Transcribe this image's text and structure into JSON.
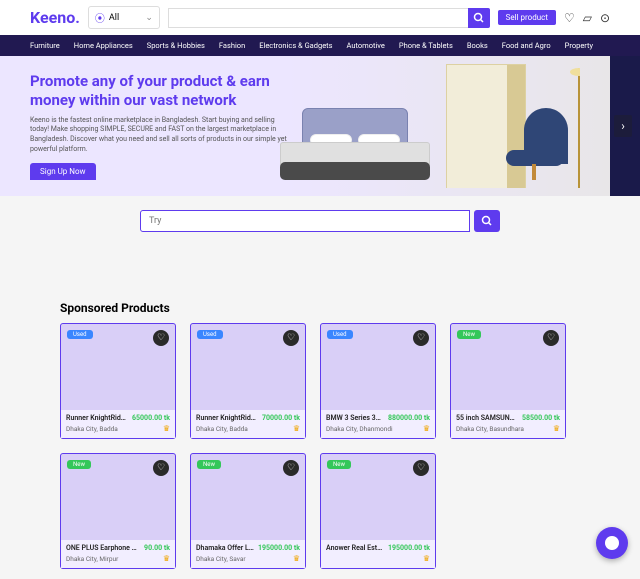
{
  "header": {
    "logo": "Keeno.",
    "category_selector": "All",
    "search_placeholder": "",
    "sell_button": "Sell product"
  },
  "nav": {
    "items": [
      "Furniture",
      "Home Appliances",
      "Sports & Hobbies",
      "Fashion",
      "Electronics & Gadgets",
      "Automotive",
      "Phone & Tablets",
      "Books",
      "Food and Agro",
      "Property"
    ]
  },
  "hero": {
    "title": "Promote any of your product & earn money within our vast network",
    "subtitle": "Keeno is the fastest online marketplace in Bangladesh. Start buying and selling today! Make shopping SIMPLE, SECURE and FAST on the largest marketplace in Bangladesh. Discover what you need and sell all sorts of products in our simple yet powerful platform.",
    "cta": "Sign Up Now"
  },
  "search_mid": {
    "placeholder": "Try"
  },
  "sponsored": {
    "title": "Sponsored Products"
  },
  "products": [
    {
      "badge": "Used",
      "title": "Runner KnightRid…",
      "price": "65000.00 tk",
      "location": "Dhaka City, Badda",
      "premium": true
    },
    {
      "badge": "Used",
      "title": "Runner KnightRid…",
      "price": "70000.00 tk",
      "location": "Dhaka City, Badda",
      "premium": true
    },
    {
      "badge": "Used",
      "title": "BMW 3 Series 318…",
      "price": "880000.00 tk",
      "location": "Dhaka City, Dhanmondi",
      "premium": true
    },
    {
      "badge": "New",
      "title": "55 inch SAMSUNG …",
      "price": "58500.00 tk",
      "location": "Dhaka City, Basundhara",
      "premium": true
    },
    {
      "badge": "New",
      "title": "ONE PLUS Earphone O…",
      "price": "90.00 tk",
      "location": "Dhaka City, Mirpur",
      "premium": true
    },
    {
      "badge": "New",
      "title": "Dhamaka Offer L…",
      "price": "195000.00 tk",
      "location": "Dhaka City, Savar",
      "premium": true
    },
    {
      "badge": "New",
      "title": "Anower Real Esta…",
      "price": "195000.00 tk",
      "location": "",
      "premium": true
    }
  ]
}
